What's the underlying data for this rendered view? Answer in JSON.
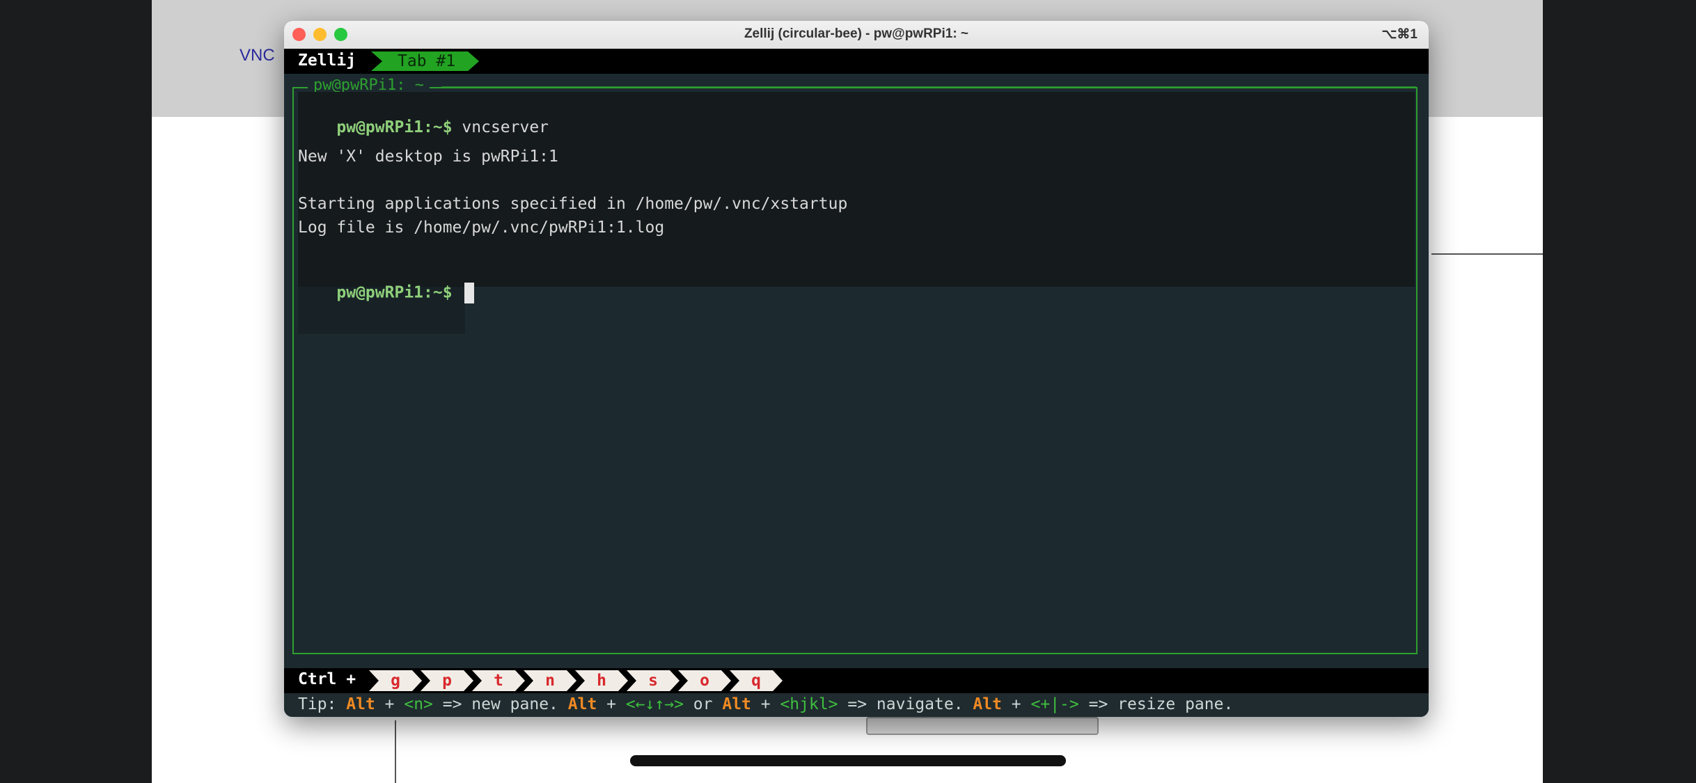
{
  "backdrop": {
    "vnc_label": "VNC"
  },
  "window": {
    "title": "Zellij (circular-bee) - pw@pwRPi1: ~",
    "shortcut": "⌥⌘1"
  },
  "tabbar": {
    "session": "Zellij",
    "active_tab": "Tab #1"
  },
  "pane": {
    "title": "pw@pwRPi1: ~"
  },
  "terminal": {
    "lines": [
      {
        "prompt": "pw@pwRPi1:~$",
        "text": " vncserver"
      },
      {
        "prompt": "",
        "text": "New 'X' desktop is pwRPi1:1"
      },
      {
        "prompt": "",
        "text": "Starting applications specified in /home/pw/.vnc/xstartup"
      },
      {
        "prompt": "",
        "text": "Log file is /home/pw/.vnc/pwRPi1:1.log"
      },
      {
        "prompt": "pw@pwRPi1:~$",
        "text": " "
      }
    ]
  },
  "statusbar": {
    "ctrl_label": "Ctrl +",
    "keys": [
      "g",
      "p",
      "t",
      "n",
      "h",
      "s",
      "o",
      "q"
    ]
  },
  "tip": {
    "prefix": "Tip: ",
    "alt": "Alt",
    "plus": " + ",
    "key_new": "<n>",
    "new_pane": " => new pane. ",
    "arrows": "<←↓↑→>",
    "or": " or ",
    "hjkl": "<hjkl>",
    "navigate": " => navigate. ",
    "resize_keys": "<+|->",
    "resize": " => resize pane."
  },
  "colors": {
    "accent_green": "#22a322",
    "alt_orange": "#f08a24",
    "key_red": "#d8282d"
  }
}
